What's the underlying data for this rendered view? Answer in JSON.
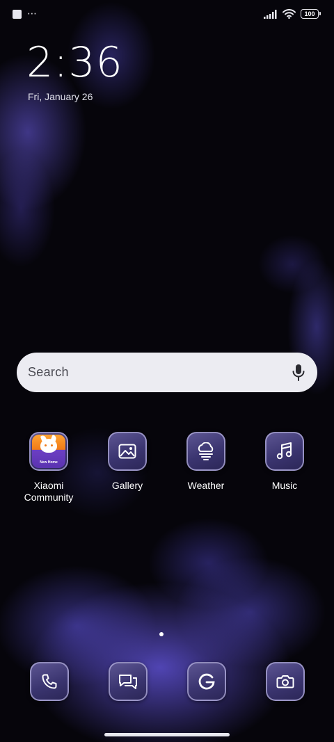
{
  "status_bar": {
    "more_indicator": "⋯",
    "battery_level": "100",
    "signal_icon": "signal-bars-icon",
    "wifi_icon": "wifi-icon"
  },
  "lockscreen_widget": {
    "time": "2:36",
    "date": "Fri, January 26"
  },
  "search": {
    "placeholder": "Search",
    "mic_icon": "microphone-icon"
  },
  "apps": [
    {
      "label": "Xiaomi\nCommunity",
      "icon": "xiaomi-community-icon",
      "badge_text": "New Home"
    },
    {
      "label": "Gallery",
      "icon": "gallery-icon"
    },
    {
      "label": "Weather",
      "icon": "weather-icon"
    },
    {
      "label": "Music",
      "icon": "music-icon"
    }
  ],
  "dock": [
    {
      "icon": "phone-icon"
    },
    {
      "icon": "messages-icon"
    },
    {
      "icon": "google-icon"
    },
    {
      "icon": "camera-icon"
    }
  ],
  "page_indicator": {
    "current": 1,
    "total": 1
  },
  "colors": {
    "tile_gradient_top": "#5c5592",
    "tile_border": "#c3beeb",
    "search_bar": "#ececf2",
    "wallpaper_accent": "#6e5feb"
  }
}
